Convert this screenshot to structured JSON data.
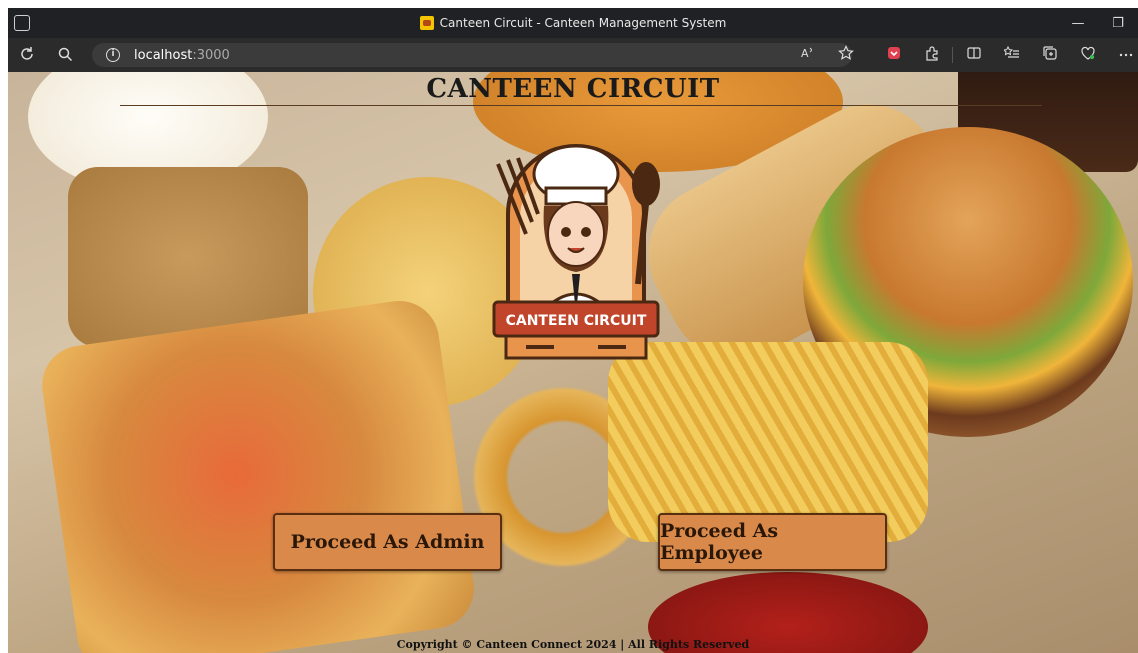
{
  "window": {
    "title": "Canteen Circuit - Canteen Management System",
    "minimize_glyph": "—",
    "restore_glyph": "❐"
  },
  "address_bar": {
    "host": "localhost",
    "port": ":3000"
  },
  "toolbar_icons": [
    "refresh-icon",
    "search-icon",
    "read-aloud-icon",
    "favorite-star-icon",
    "pocket-icon",
    "extensions-icon",
    "split-screen-icon",
    "favorites-list-icon",
    "collections-icon",
    "health-icon",
    "more-icon"
  ],
  "page": {
    "heading": "CANTEEN CIRCUIT",
    "logo_text": "CANTEEN CIRCUIT",
    "admin_button": "Proceed As Admin",
    "employee_button": "Proceed As Employee",
    "copyright": "Copyright © Canteen Connect 2024 | All Rights Reserved"
  },
  "colors": {
    "button_bg": "#d98a4b",
    "button_border": "#5a2e10",
    "logo_banner": "#c0452a"
  }
}
